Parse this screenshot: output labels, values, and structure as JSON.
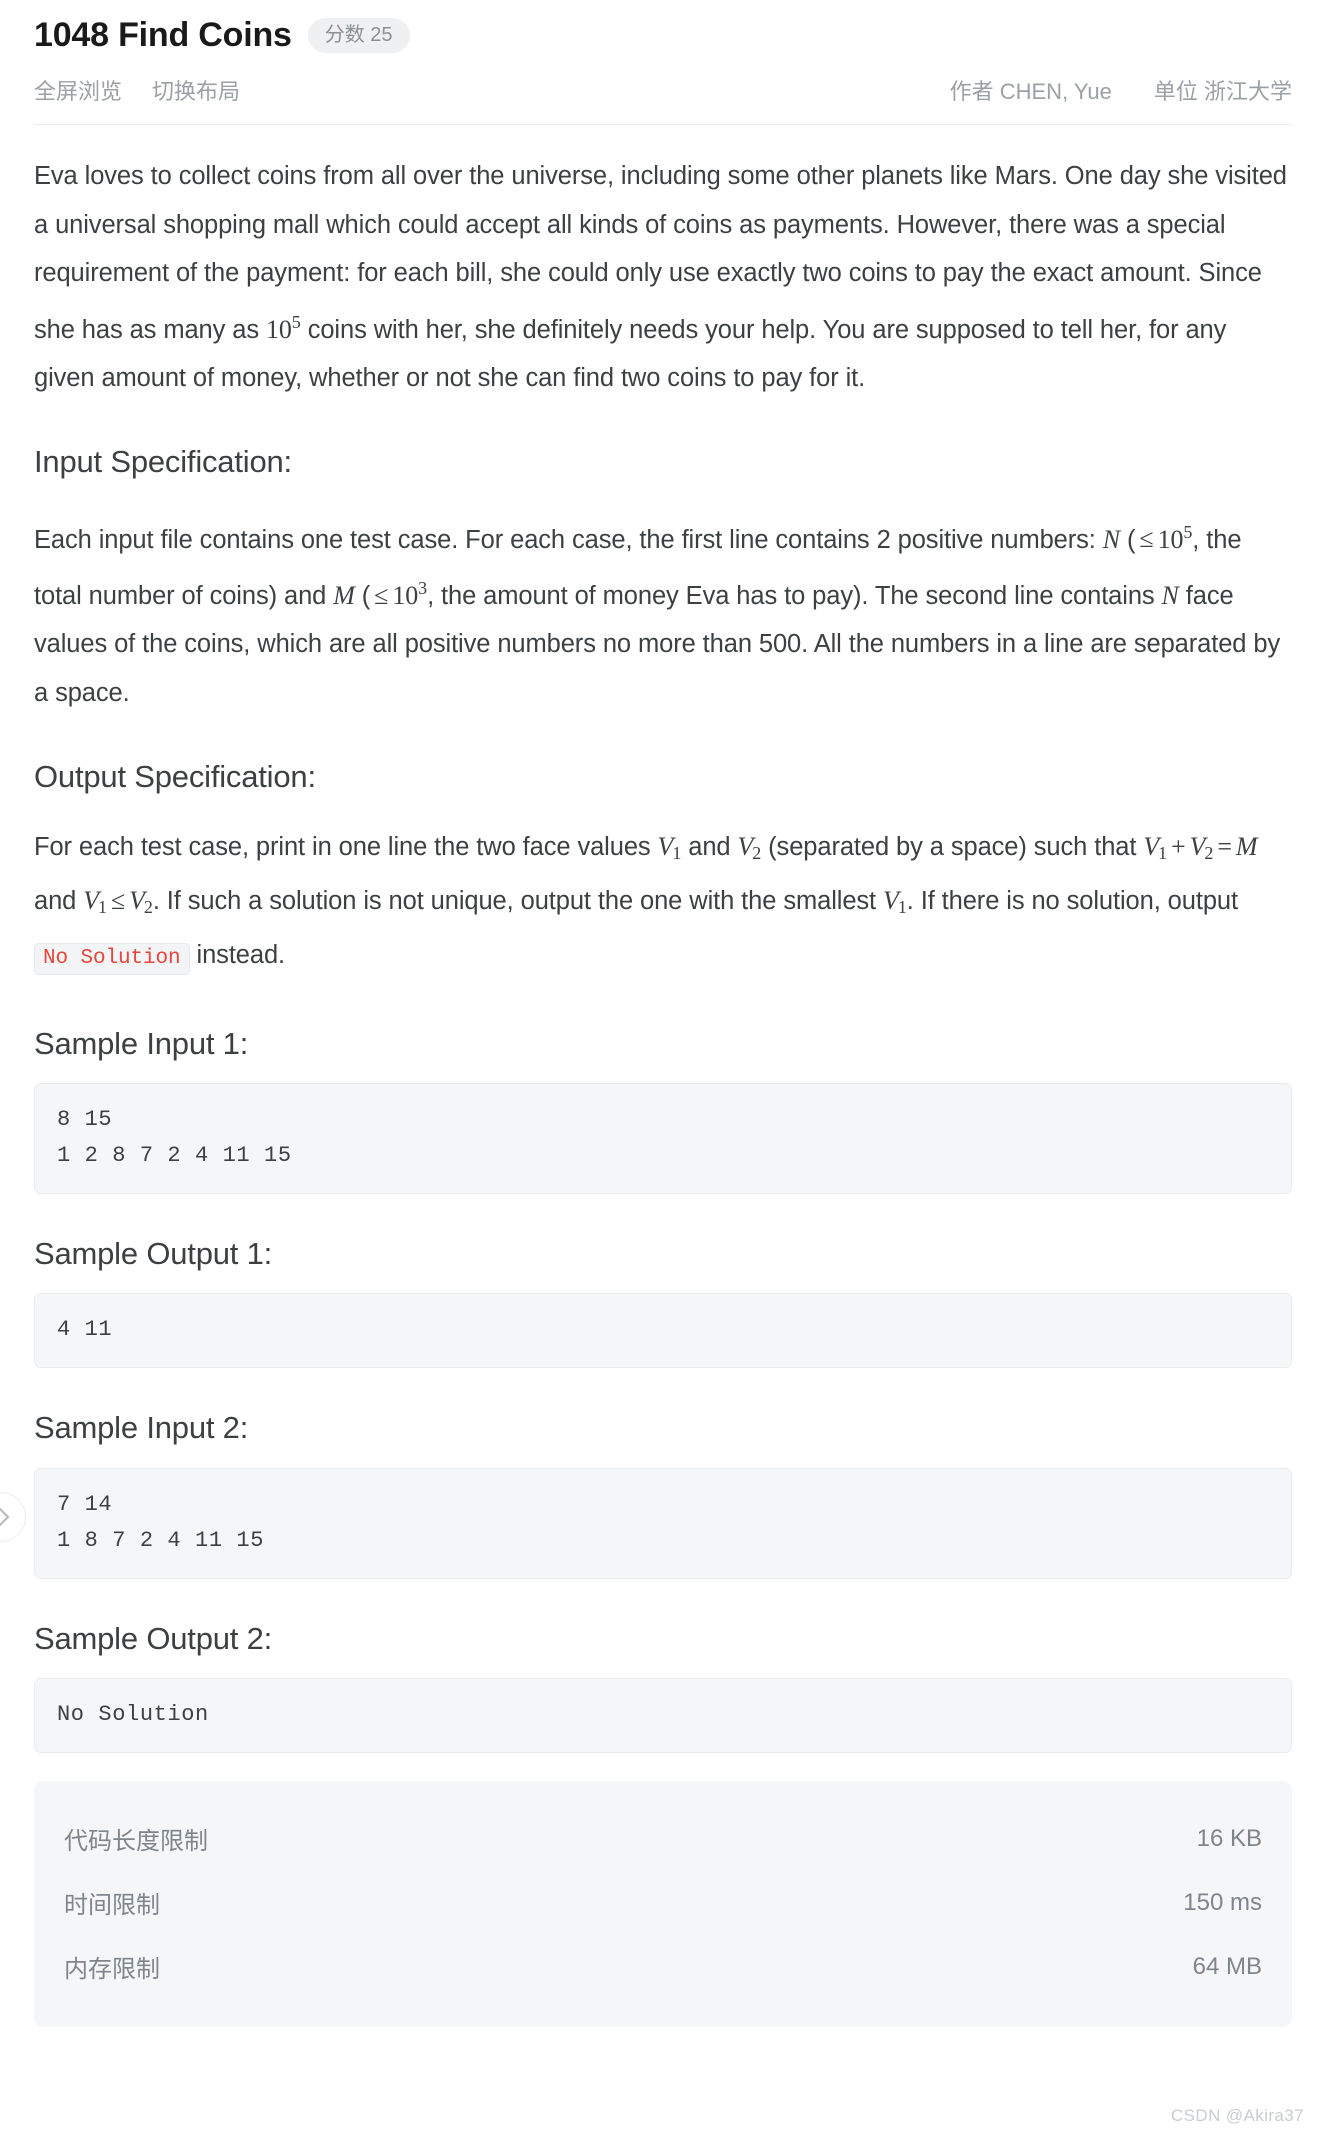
{
  "header": {
    "problem_title": "1048 Find Coins",
    "score_label": "分数",
    "score_value": "25",
    "links": [
      "全屏浏览",
      "切换布局"
    ],
    "author_key": "作者",
    "author_value": "CHEN, Yue",
    "org_key": "单位",
    "org_value": "浙江大学"
  },
  "description": {
    "p1_a": "Eva loves to collect coins from all over the universe, including some other planets like Mars. One day she visited a universal shopping mall which could accept all kinds of coins as payments. However, there was a special requirement of the payment: for each bill, she could only use exactly two coins to pay the exact amount. Since she has as many as ",
    "p1_base": "10",
    "p1_exp": "5",
    "p1_b": " coins with her, she definitely needs your help. You are supposed to tell her, for any given amount of money, whether or not she can find two coins to pay for it."
  },
  "input_spec": {
    "heading": "Input Specification:",
    "t1": "Each input file contains one test case. For each case, the first line contains 2 positive numbers: ",
    "var_n": "N",
    "t2": " (",
    "le": "≤",
    "sp": " ",
    "base10": "10",
    "exp5": "5",
    "t3": ", the total number of coins) and ",
    "var_m": "M",
    "t4": " (",
    "exp3": "3",
    "t5": ", the amount of money Eva has to pay). The second line contains ",
    "var_n2": "N",
    "t6": " face values of the coins, which are all positive numbers no more than 500. All the numbers in a line are separated by a space."
  },
  "output_spec": {
    "heading": "Output Specification:",
    "t1": "For each test case, print in one line the two face values ",
    "v1": "V",
    "sub1": "1",
    "t2": " and ",
    "v2": "V",
    "sub2": "2",
    "t3": " (separated by a space) such that ",
    "plus": "+",
    "eq": "=",
    "var_m": "M",
    "t4": " and ",
    "le": "≤",
    "t5": ". If such a solution is not unique, output the one with the smallest ",
    "t6": ". If there is no solution, output ",
    "code_no_solution": "No Solution",
    "t7": " instead."
  },
  "samples": [
    {
      "heading": "Sample Input 1:",
      "code": "8 15\n1 2 8 7 2 4 11 15"
    },
    {
      "heading": "Sample Output 1:",
      "code": "4 11"
    },
    {
      "heading": "Sample Input 2:",
      "code": "7 14\n1 8 7 2 4 11 15"
    },
    {
      "heading": "Sample Output 2:",
      "code": "No Solution"
    }
  ],
  "limits": [
    {
      "label": "代码长度限制",
      "value": "16 KB"
    },
    {
      "label": "时间限制",
      "value": "150 ms"
    },
    {
      "label": "内存限制",
      "value": "64 MB"
    }
  ],
  "side_nav": {
    "icon": "chevron-right-icon"
  },
  "watermark": "CSDN @Akira37"
}
